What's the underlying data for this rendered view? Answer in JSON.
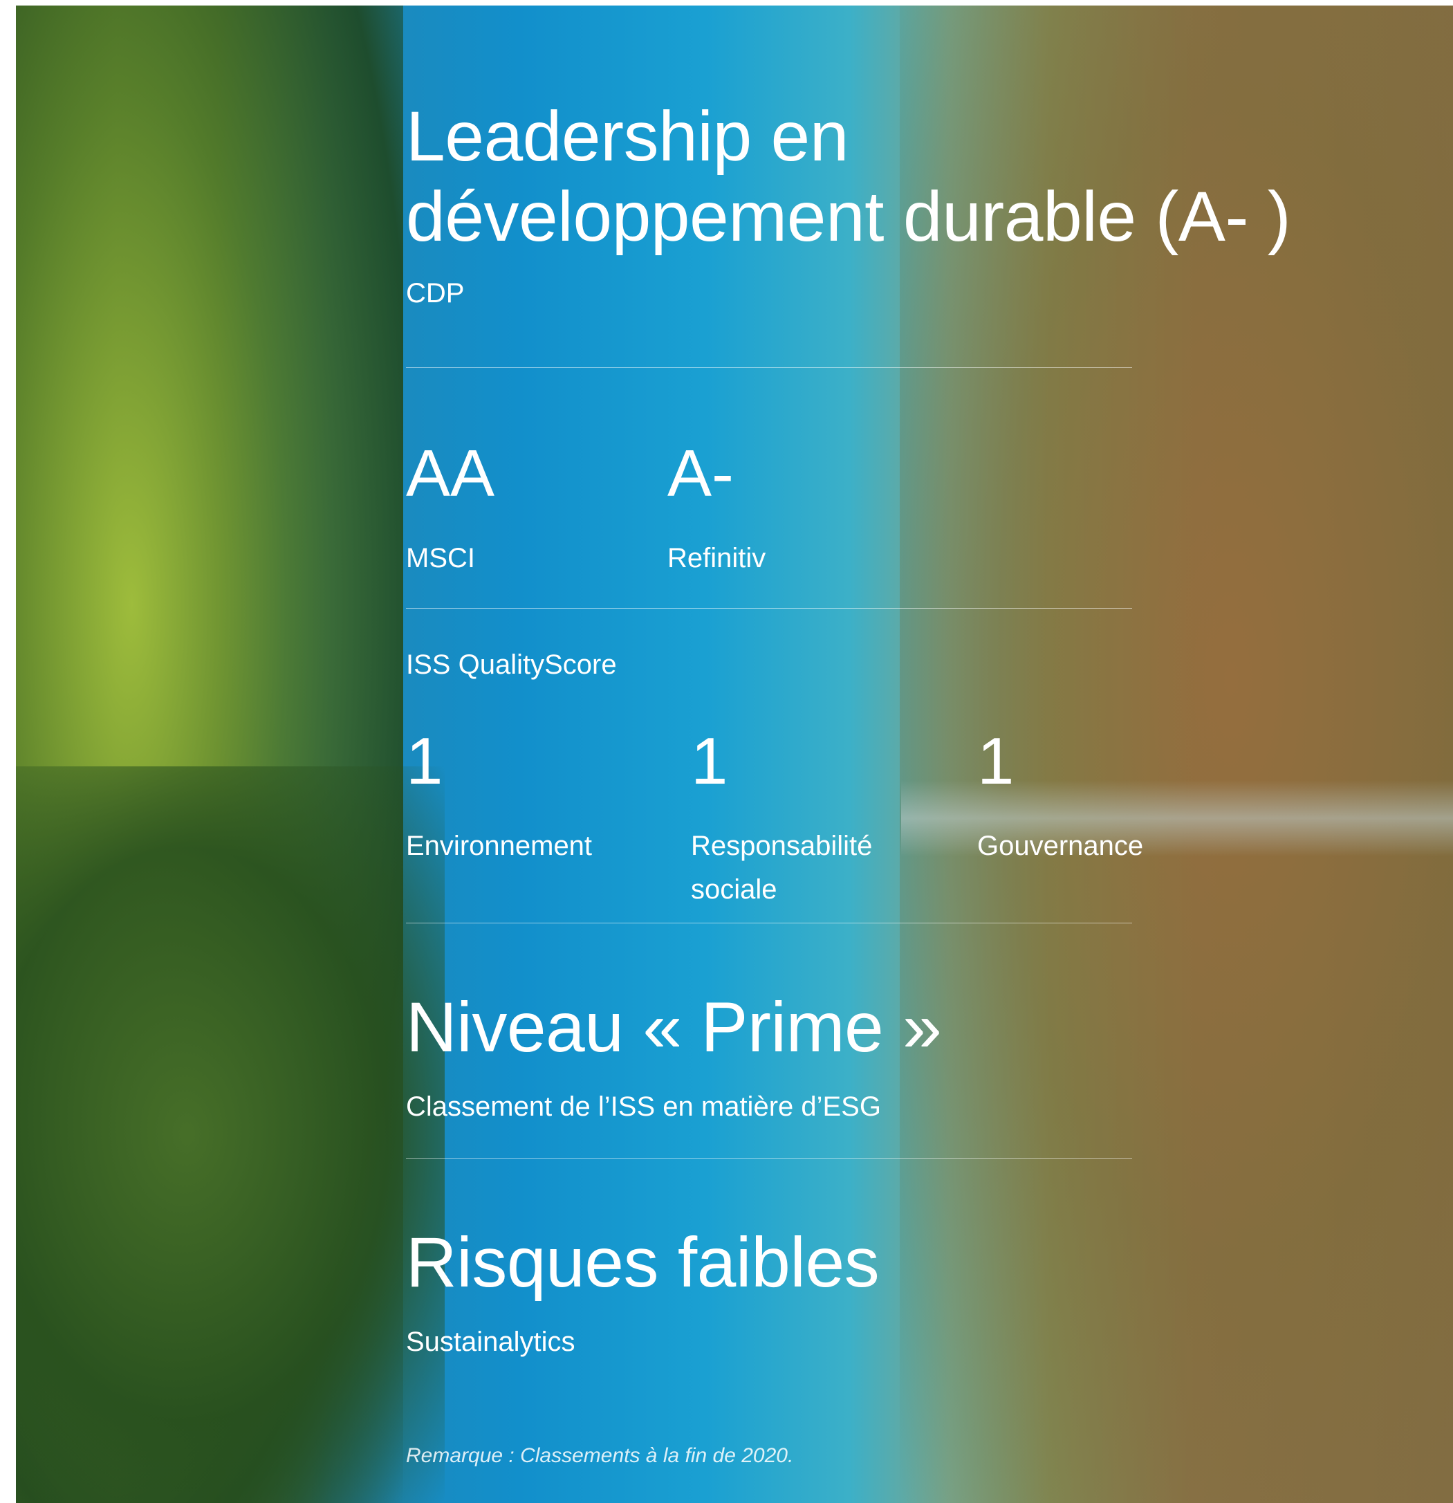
{
  "cdp": {
    "title_line1": "Leadership en",
    "title_line2": "développement durable (A- )",
    "source": "CDP"
  },
  "msci": {
    "score": "AA",
    "label": "MSCI"
  },
  "refinitiv": {
    "score": "A-",
    "label": "Refinitiv"
  },
  "iss_quality": {
    "heading": "ISS QualityScore",
    "items": [
      {
        "score": "1",
        "label_line1": "Environnement",
        "label_line2": ""
      },
      {
        "score": "1",
        "label_line1": "Responsabilité",
        "label_line2": "sociale"
      },
      {
        "score": "1",
        "label_line1": "Gouvernance",
        "label_line2": ""
      }
    ]
  },
  "iss_esg": {
    "title": "Niveau « Prime »",
    "source": "Classement de l’ISS en matière d’ESG"
  },
  "sustainalytics": {
    "title": "Risques faibles",
    "source": "Sustainalytics"
  },
  "note": "Remarque : Classements à la fin de 2020."
}
